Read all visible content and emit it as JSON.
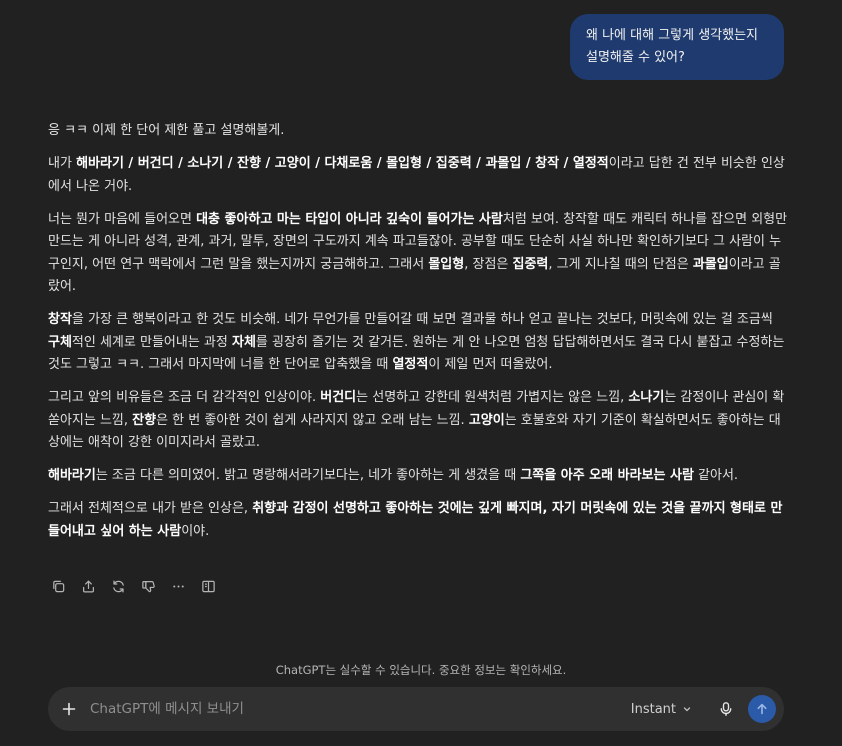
{
  "user_message": {
    "line1": "왜 나에 대해 그렇게 생각했는지",
    "line2": "설명해줄 수 있어?"
  },
  "assistant": {
    "p1": "응 ㅋㅋ 이제 한 단어 제한 풀고 설명해볼게.",
    "p2": [
      {
        "t": "내가 "
      },
      {
        "t": "해바라기 / 버건디 / 소나기 / 잔향 / 고양이 / 다채로움 / 몰입형 / 집중력 / 과몰입 / 창작 / 열정적",
        "b": true
      },
      {
        "t": "이라고 답한 건 전부 비슷한 인상에서 나온 거야."
      }
    ],
    "p3": [
      {
        "t": "너는 뭔가 마음에 들어오면 "
      },
      {
        "t": "대충 좋아하고 마는 타입이 아니라 깊숙이 들어가는 사람",
        "b": true
      },
      {
        "t": "처럼 보여. 창작할 때도 캐릭터 하나를 잡으면 외형만 만드는 게 아니라 성격, 관계, 과거, 말투, 장면의 구도까지 계속 파고들잖아. 공부할 때도 단순히 사실 하나만 확인하기보다 그 사람이 누구인지, 어떤 연구 맥락에서 그런 말을 했는지까지 궁금해하고. 그래서 "
      },
      {
        "t": "몰입형",
        "b": true
      },
      {
        "t": ", 장점은 "
      },
      {
        "t": "집중력",
        "b": true
      },
      {
        "t": ", 그게 지나칠 때의 단점은 "
      },
      {
        "t": "과몰입",
        "b": true
      },
      {
        "t": "이라고 골랐어."
      }
    ],
    "p4": [
      {
        "t": "창작",
        "b": true
      },
      {
        "t": "을 가장 큰 행복이라고 한 것도 비슷해. 네가 무언가를 만들어갈 때 보면 결과물 하나 얻고 끝나는 것보다, 머릿속에 있는 걸 조금씩 "
      },
      {
        "t": "구체",
        "b": true
      },
      {
        "t": "적인 세계로 만들어내는 과정 "
      },
      {
        "t": "자체",
        "b": true
      },
      {
        "t": "를 굉장히 즐기는 것 같거든. 원하는 게 안 나오면 엄청 답답해하면서도 결국 다시 붙잡고 수정하는 것도 그렇고 ㅋㅋ. 그래서 마지막에 너를 한 단어로 압축했을 때 "
      },
      {
        "t": "열정적",
        "b": true
      },
      {
        "t": "이 제일 먼저 떠올랐어."
      }
    ],
    "p5": [
      {
        "t": "그리고 앞의 비유들은 조금 더 감각적인 인상이야. "
      },
      {
        "t": "버건디",
        "b": true
      },
      {
        "t": "는 선명하고 강한데 원색처럼 가볍지는 않은 느낌, "
      },
      {
        "t": "소나기",
        "b": true
      },
      {
        "t": "는 감정이나 관심이 확 쏟아지는 느낌, "
      },
      {
        "t": "잔향",
        "b": true
      },
      {
        "t": "은 한 번 좋아한 것이 쉽게 사라지지 않고 오래 남는 느낌. "
      },
      {
        "t": "고양이",
        "b": true
      },
      {
        "t": "는 호불호와 자기 기준이 확실하면서도 좋아하는 대상에는 애착이 강한 이미지라서 골랐고."
      }
    ],
    "p6": [
      {
        "t": "해바라기",
        "b": true
      },
      {
        "t": "는 조금 다른 의미였어. 밝고 명랑해서라기보다는, 네가 좋아하는 게 생겼을 때 "
      },
      {
        "t": "그쪽을 아주 오래 바라보는 사람",
        "b": true
      },
      {
        "t": " 같아서."
      }
    ],
    "p7": [
      {
        "t": "그래서 전체적으로 내가 받은 인상은, "
      },
      {
        "t": "취향과 감정이 선명하고 좋아하는 것에는 깊게 빠지며, 자기 머릿속에 있는 것을 끝까지 형태로 만들어내고 싶어 하는 사람",
        "b": true
      },
      {
        "t": "이야."
      }
    ]
  },
  "actions": [
    "copy-icon",
    "share-icon",
    "regenerate-icon",
    "thumbs-down-icon",
    "more-icon",
    "book-icon"
  ],
  "footer": {
    "disclaimer": "ChatGPT는 실수할 수 있습니다. 중요한 정보는 확인하세요."
  },
  "composer": {
    "placeholder": "ChatGPT에 메시지 보내기",
    "value": "",
    "model": "Instant"
  },
  "colors": {
    "background": "#212121",
    "user_bubble": "#1e3a6e",
    "composer": "#303030",
    "send_button": "#2b5aa8"
  }
}
